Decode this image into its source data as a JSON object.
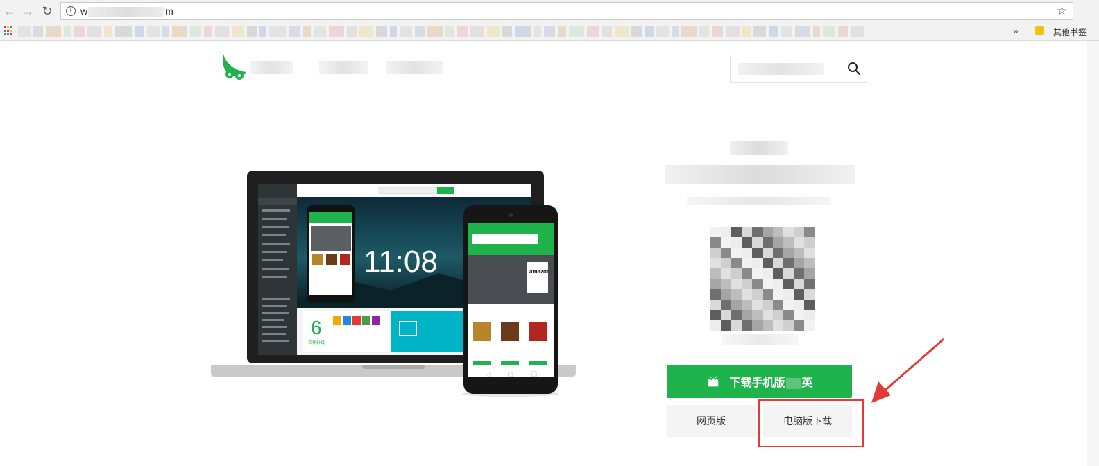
{
  "browser": {
    "url_prefix": "w",
    "url_suffix": "m",
    "bookmarks_more": "»",
    "other_bookmarks": "其他书签"
  },
  "header": {
    "search_placeholder": ""
  },
  "hero": {
    "laptop_clock": "11:08",
    "phone_brand_card": "amazon",
    "laptop_update_count": "6",
    "laptop_update_label": "软件升级"
  },
  "buttons": {
    "download_mobile": "下载手机版",
    "download_mobile_suffix": "英",
    "web_version": "网页版",
    "pc_download": "电脑版下载"
  },
  "colors": {
    "brand_green": "#1fb34b",
    "annotation_red": "#e53935"
  }
}
